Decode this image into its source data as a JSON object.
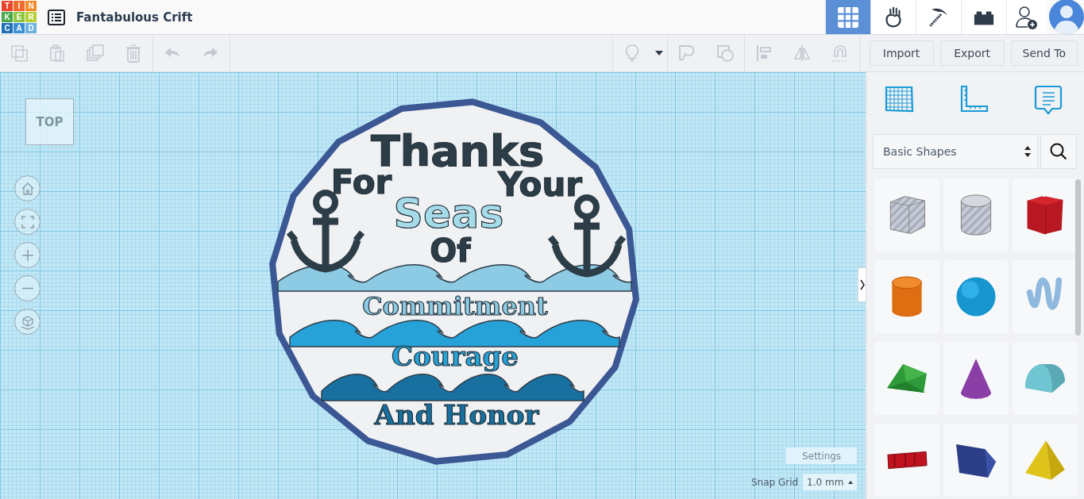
{
  "header": {
    "logo": [
      {
        "letter": "T",
        "color": "#e8452c"
      },
      {
        "letter": "I",
        "color": "#f06a2b"
      },
      {
        "letter": "N",
        "color": "#f58a25"
      },
      {
        "letter": "K",
        "color": "#4aa84a"
      },
      {
        "letter": "E",
        "color": "#8cc63f"
      },
      {
        "letter": "R",
        "color": "#b6cf33"
      },
      {
        "letter": "C",
        "color": "#1f6eb8"
      },
      {
        "letter": "A",
        "color": "#3a8fd4"
      },
      {
        "letter": "D",
        "color": "#6bb2e0"
      }
    ],
    "design_title": "Fantabulous Crift",
    "modes": [
      {
        "kind": "grid",
        "selected": true
      },
      {
        "kind": "hand",
        "selected": false
      },
      {
        "kind": "pickaxe",
        "selected": false
      },
      {
        "kind": "brick",
        "selected": false
      }
    ]
  },
  "toolbar": {
    "tools": [
      {
        "kind": "copy",
        "disabled": true
      },
      {
        "kind": "paste",
        "disabled": true
      },
      {
        "kind": "duplicate",
        "disabled": true
      },
      {
        "kind": "delete",
        "disabled": true
      },
      {
        "kind": "undo",
        "disabled": true
      },
      {
        "kind": "redo",
        "disabled": true
      },
      {
        "kind": "light",
        "disabled": true
      },
      {
        "kind": "solid",
        "disabled": true
      },
      {
        "kind": "hole",
        "disabled": true
      },
      {
        "kind": "align",
        "disabled": true
      },
      {
        "kind": "mirror",
        "disabled": true
      },
      {
        "kind": "magnet",
        "disabled": true
      }
    ],
    "buttons": [
      "Import",
      "Export",
      "Send To"
    ]
  },
  "canvas": {
    "view_cube": "TOP",
    "nav": [
      {
        "kind": "home"
      },
      {
        "kind": "fit"
      },
      {
        "kind": "zoom-in"
      },
      {
        "kind": "zoom-out"
      },
      {
        "kind": "perspective"
      }
    ],
    "design_texts": [
      {
        "text": "Thanks",
        "kind": "dark"
      },
      {
        "text": "For",
        "kind": "dark"
      },
      {
        "text": "Your",
        "kind": "dark"
      },
      {
        "text": "Seas",
        "kind": "light"
      },
      {
        "text": "Of",
        "kind": "dark"
      },
      {
        "text": "Commitment",
        "kind": "pale"
      },
      {
        "text": "Courage",
        "kind": "mid"
      },
      {
        "text": "And Honor",
        "kind": "deep"
      }
    ],
    "settings": "Settings",
    "snap_grid_label": "Snap Grid",
    "snap_grid_value": "1.0 mm"
  },
  "panel": {
    "tabs": [
      {
        "kind": "grid",
        "selected": false
      },
      {
        "kind": "ruler",
        "selected": false
      },
      {
        "kind": "notes",
        "selected": false
      }
    ],
    "category": "Basic Shapes",
    "shapes": [
      {
        "kind": "box-hole"
      },
      {
        "kind": "cylinder-hole"
      },
      {
        "kind": "box"
      },
      {
        "kind": "cylinder"
      },
      {
        "kind": "sphere"
      },
      {
        "kind": "scribble"
      },
      {
        "kind": "roof"
      },
      {
        "kind": "cone"
      },
      {
        "kind": "round-roof"
      },
      {
        "kind": "text"
      },
      {
        "kind": "prism"
      },
      {
        "kind": "pyramid"
      }
    ]
  }
}
